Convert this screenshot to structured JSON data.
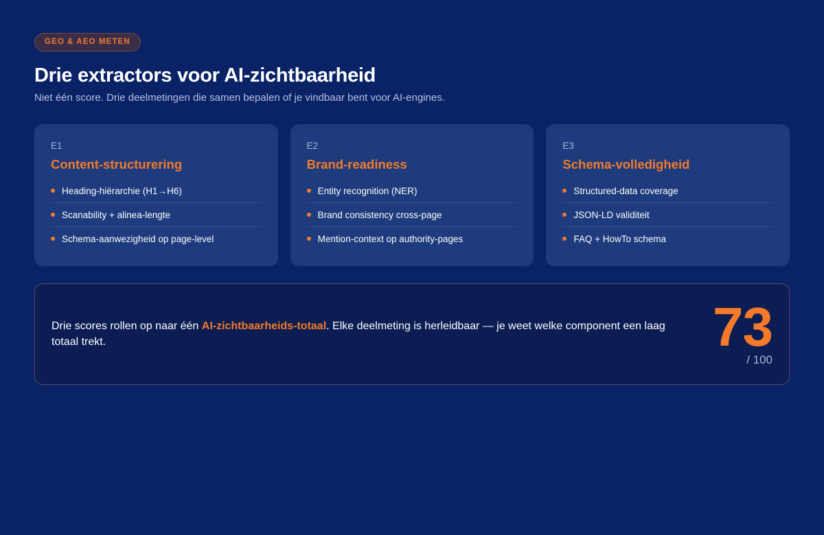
{
  "badge": "GEO & AEO METEN",
  "title": "Drie extractors voor AI-zichtbaarheid",
  "subtitle": "Niet één score. Drie deelmetingen die samen bepalen of je vindbaar bent voor AI-engines.",
  "cards": [
    {
      "code": "E1",
      "title": "Content-structurering",
      "items": [
        "Heading-hiërarchie (H1→H6)",
        "Scanability + alinea-lengte",
        "Schema-aanwezigheid op page-level"
      ]
    },
    {
      "code": "E2",
      "title": "Brand-readiness",
      "items": [
        "Entity recognition (NER)",
        "Brand consistency cross-page",
        "Mention-context op authority-pages"
      ]
    },
    {
      "code": "E3",
      "title": "Schema-volledigheid",
      "items": [
        "Structured-data coverage",
        "JSON-LD validiteit",
        "FAQ + HowTo schema"
      ]
    }
  ],
  "summary": {
    "text_before": "Drie scores rollen op naar één ",
    "highlight": "AI-zichtbaarheids-totaal",
    "text_after": ". Elke deelmeting is herleidbaar — je weet welke component een laag totaal trekt.",
    "score": "73",
    "score_max": "/ 100"
  },
  "colors": {
    "background": "#0a2266",
    "card": "#1d3b7d",
    "accent": "#f47a2a",
    "summary_bg": "#0b1d52"
  }
}
